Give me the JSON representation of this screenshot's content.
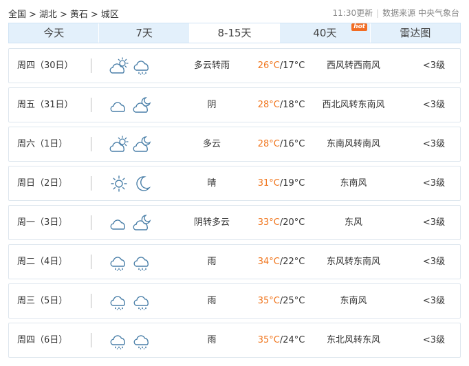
{
  "breadcrumb": {
    "items": [
      "全国",
      "湖北",
      "黄石",
      "城区"
    ],
    "separator": ">"
  },
  "update": {
    "time_label": "11:30更新",
    "source_label": "数据来源 中央气象台"
  },
  "tabs": [
    {
      "label": "今天",
      "active": false
    },
    {
      "label": "7天",
      "active": false
    },
    {
      "label": "8-15天",
      "active": true
    },
    {
      "label": "40天",
      "active": false,
      "badge": "hot"
    },
    {
      "label": "雷达图",
      "active": false
    }
  ],
  "colors": {
    "high_temp": "#f0761e",
    "tab_bg": "#e3f0fb",
    "icon_stroke": "#4a7fa8"
  },
  "forecast": [
    {
      "day": "周四（30日）",
      "icons": [
        "partly-cloudy-day-icon",
        "rain-icon"
      ],
      "desc": "多云转雨",
      "high": "26°C",
      "low": "/17°C",
      "wind": "西风转西南风",
      "level": "<3级"
    },
    {
      "day": "周五（31日）",
      "icons": [
        "cloudy-icon",
        "partly-cloudy-night-icon"
      ],
      "desc": "阴",
      "high": "28°C",
      "low": "/18°C",
      "wind": "西北风转东南风",
      "level": "<3级"
    },
    {
      "day": "周六（1日）",
      "icons": [
        "partly-cloudy-day-icon",
        "partly-cloudy-night-icon"
      ],
      "desc": "多云",
      "high": "28°C",
      "low": "/16°C",
      "wind": "东南风转南风",
      "level": "<3级"
    },
    {
      "day": "周日（2日）",
      "icons": [
        "sun-icon",
        "moon-icon"
      ],
      "desc": "晴",
      "high": "31°C",
      "low": "/19°C",
      "wind": "东南风",
      "level": "<3级"
    },
    {
      "day": "周一（3日）",
      "icons": [
        "cloudy-icon",
        "partly-cloudy-night-icon"
      ],
      "desc": "阴转多云",
      "high": "33°C",
      "low": "/20°C",
      "wind": "东风",
      "level": "<3级"
    },
    {
      "day": "周二（4日）",
      "icons": [
        "rain-icon",
        "rain-icon"
      ],
      "desc": "雨",
      "high": "34°C",
      "low": "/22°C",
      "wind": "东风转东南风",
      "level": "<3级"
    },
    {
      "day": "周三（5日）",
      "icons": [
        "rain-icon",
        "rain-icon"
      ],
      "desc": "雨",
      "high": "35°C",
      "low": "/25°C",
      "wind": "东南风",
      "level": "<3级"
    },
    {
      "day": "周四（6日）",
      "icons": [
        "rain-icon",
        "rain-icon"
      ],
      "desc": "雨",
      "high": "35°C",
      "low": "/24°C",
      "wind": "东北风转东风",
      "level": "<3级"
    }
  ]
}
